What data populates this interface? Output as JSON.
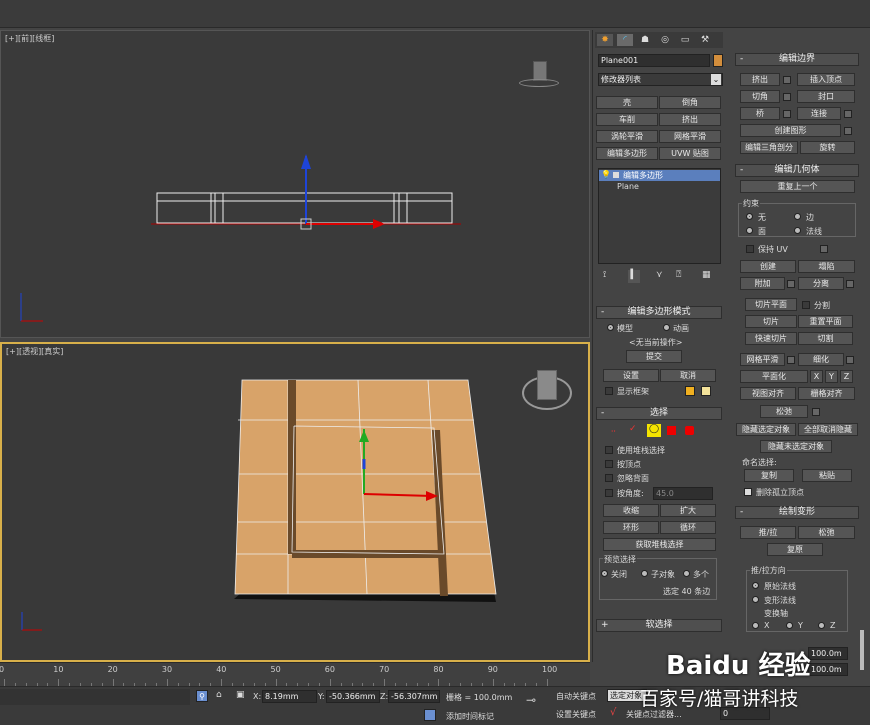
{
  "viewports": {
    "top_label": "[+][前][线框]",
    "persp_label": "[+][透视][真实]"
  },
  "command_panel": {
    "object_name": "Plane001",
    "modifier_list": "修改器列表",
    "color": "#d38e3c",
    "buttons": [
      "壳",
      "倒角",
      "车削",
      "挤出",
      "涡轮平滑",
      "网格平滑",
      "编辑多边形",
      "UVW 贴图"
    ],
    "stack": [
      {
        "label": "编辑多边形",
        "selected": true
      },
      {
        "label": "Plane",
        "selected": false
      }
    ],
    "edit_poly_mode": {
      "title": "编辑多边形模式",
      "model": "模型",
      "animate": "动画",
      "no_op": "<无当前操作>",
      "commit": "提交",
      "settings": "设置",
      "cancel": "取消",
      "show_cage": "显示框架"
    },
    "selection": {
      "title": "选择",
      "by_vertex": "使用堆栈选择",
      "by_vertex2": "按顶点",
      "ignore_backfacing": "忽略背面",
      "by_angle": "按角度:",
      "angle": "45.0",
      "shrink": "收缩",
      "grow": "扩大",
      "ring": "环形",
      "loop": "循环",
      "get_stack": "获取堆栈选择",
      "preview_title": "预览选择",
      "off": "关闭",
      "subobj": "子对象",
      "multi": "多个",
      "selected_count": "选定 40 条边"
    },
    "soft_selection": "软选择"
  },
  "right_panel": {
    "edit_edges": {
      "title": "编辑边界",
      "extrude": "挤出",
      "insert_vertex": "插入顶点",
      "chamfer": "切角",
      "cap": "封口",
      "bridge": "桥",
      "connect": "连接",
      "create_shape": "创建图形",
      "edit_tri": "编辑三角剖分",
      "rotate": "旋转"
    },
    "edit_geometry": {
      "title": "编辑几何体",
      "repeat": "重复上一个",
      "constraints": "约束",
      "none": "无",
      "edge": "边",
      "face": "面",
      "normal": "法线",
      "preserve_uv": "保持 UV",
      "create": "创建",
      "collapse": "塌陷",
      "attach": "附加",
      "detach": "分离",
      "slice_plane": "切片平面",
      "split": "分割",
      "slice": "切片",
      "reset_plane": "重置平面",
      "quickslice": "快速切片",
      "cut": "切割",
      "meshsmooth": "网格平滑",
      "tessellate": "细化",
      "make_planar": "平面化",
      "x": "X",
      "y": "Y",
      "z": "Z",
      "view_align": "视图对齐",
      "grid_align": "栅格对齐",
      "relax": "松弛",
      "hide_sel": "隐藏选定对象",
      "unhide_all": "全部取消隐藏",
      "hide_unsel": "隐藏未选定对象",
      "named_sel": "命名选择:",
      "copy": "复制",
      "paste": "粘贴",
      "delete_iso": "删除孤立顶点"
    },
    "paint_deform": {
      "title": "绘制变形",
      "push_pull": "推/拉",
      "relax": "松弛",
      "revert": "复原",
      "direction": "推/拉方向",
      "orig_normals": "原始法线",
      "deformed_normals": "变形法线",
      "transform_axis": "变换轴",
      "x": "X",
      "y": "Y",
      "z": "Z",
      "value1": "100.0m",
      "value2": "100.0m"
    }
  },
  "timeline": {
    "ticks": [
      "0",
      "10",
      "20",
      "30",
      "40",
      "50",
      "60",
      "70",
      "80",
      "90",
      "100"
    ]
  },
  "status": {
    "x_label": "X:",
    "x": "8.19mm",
    "y_label": "Y:",
    "y": "-50.366mm",
    "z_label": "Z:",
    "z": "-56.307mm",
    "grid": "栅格 = 100.0mm",
    "auto_key": "自动关键点",
    "selected": "选定对象",
    "set_key": "设置关键点",
    "key_filters": "关键点过滤器...",
    "add_time_tag": "添加时间标记",
    "frame": "0"
  },
  "watermark": {
    "brand": "Baidu 经验",
    "caption": "百家号/猫哥讲科技"
  }
}
